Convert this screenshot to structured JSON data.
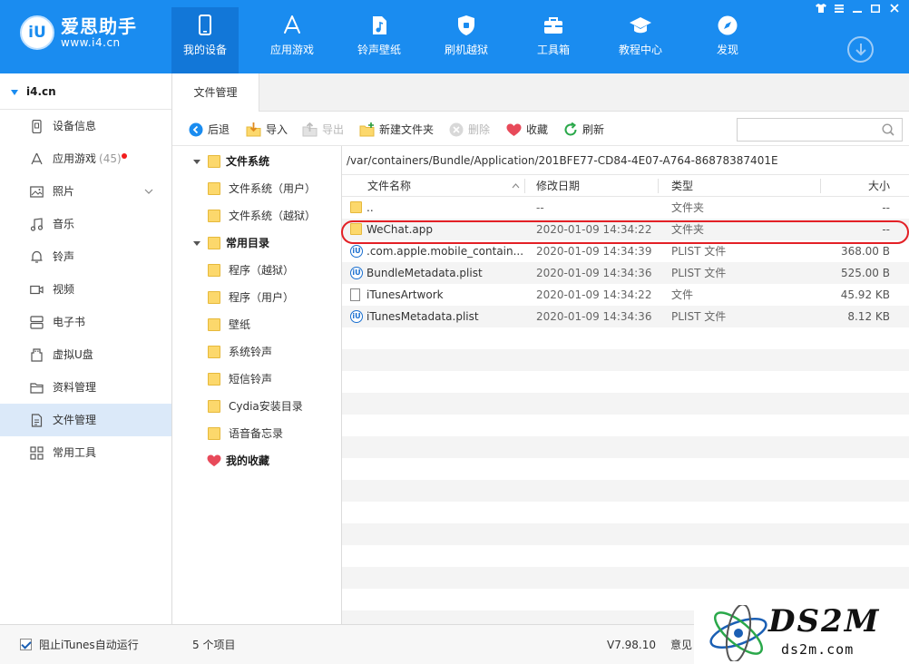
{
  "app": {
    "logo_badge": "iU",
    "logo_name": "爱思助手",
    "logo_url": "www.i4.cn"
  },
  "nav": [
    {
      "label": "我的设备",
      "icon": "phone-icon",
      "active": true
    },
    {
      "label": "应用游戏",
      "icon": "app-store-icon"
    },
    {
      "label": "铃声壁纸",
      "icon": "music-file-icon"
    },
    {
      "label": "刷机越狱",
      "icon": "shield-icon"
    },
    {
      "label": "工具箱",
      "icon": "toolbox-icon"
    },
    {
      "label": "教程中心",
      "icon": "graduation-cap-icon"
    },
    {
      "label": "发现",
      "icon": "compass-icon"
    }
  ],
  "colors": {
    "accent": "#1a8cf0",
    "nav_active": "#1277d8",
    "selected_row": "#dbe9f9",
    "highlight": "#e32026",
    "folder": "#fcd86c"
  },
  "sidebar": {
    "device": "i4.cn",
    "items": [
      {
        "label": "设备信息",
        "icon": "device-info-icon"
      },
      {
        "label": "应用游戏",
        "icon": "apps-icon",
        "count": "(45)",
        "badge": true
      },
      {
        "label": "照片",
        "icon": "photo-icon",
        "expandable": true
      },
      {
        "label": "音乐",
        "icon": "music-note-icon"
      },
      {
        "label": "铃声",
        "icon": "bell-icon"
      },
      {
        "label": "视频",
        "icon": "video-icon"
      },
      {
        "label": "电子书",
        "icon": "ebook-icon"
      },
      {
        "label": "虚拟U盘",
        "icon": "usb-drive-icon"
      },
      {
        "label": "资料管理",
        "icon": "folder-outline-icon"
      },
      {
        "label": "文件管理",
        "icon": "document-icon",
        "active": true
      },
      {
        "label": "常用工具",
        "icon": "grid-icon"
      }
    ]
  },
  "tabs": [
    {
      "label": "文件管理"
    }
  ],
  "toolbar": {
    "back": "后退",
    "import": "导入",
    "export": "导出",
    "new_folder": "新建文件夹",
    "delete": "删除",
    "favorite": "收藏",
    "refresh": "刷新",
    "search_placeholder": ""
  },
  "tree": [
    {
      "label": "文件系统",
      "group": true
    },
    {
      "label": "文件系统（用户）"
    },
    {
      "label": "文件系统（越狱）"
    },
    {
      "label": "常用目录",
      "group": true
    },
    {
      "label": "程序（越狱）"
    },
    {
      "label": "程序（用户）"
    },
    {
      "label": "壁纸"
    },
    {
      "label": "系统铃声"
    },
    {
      "label": "短信铃声"
    },
    {
      "label": "Cydia安装目录"
    },
    {
      "label": "语音备忘录"
    },
    {
      "label": "我的收藏",
      "favorite": true
    }
  ],
  "path": "/var/containers/Bundle/Application/201BFE77-CD84-4E07-A764-86878387401E",
  "columns": {
    "name": "文件名称",
    "date": "修改日期",
    "type": "类型",
    "size": "大小"
  },
  "files": [
    {
      "name": "..",
      "date": "--",
      "type": "文件夹",
      "size": "--",
      "icon": "folder"
    },
    {
      "name": "WeChat.app",
      "date": "2020-01-09 14:34:22",
      "type": "文件夹",
      "size": "--",
      "icon": "folder",
      "highlighted": true
    },
    {
      "name": ".com.apple.mobile_contain...",
      "date": "2020-01-09 14:34:39",
      "type": "PLIST 文件",
      "size": "368.00 B",
      "icon": "itunes"
    },
    {
      "name": "BundleMetadata.plist",
      "date": "2020-01-09 14:34:36",
      "type": "PLIST 文件",
      "size": "525.00 B",
      "icon": "itunes"
    },
    {
      "name": "iTunesArtwork",
      "date": "2020-01-09 14:34:22",
      "type": "文件",
      "size": "45.92 KB",
      "icon": "doc"
    },
    {
      "name": "iTunesMetadata.plist",
      "date": "2020-01-09 14:34:36",
      "type": "PLIST 文件",
      "size": "8.12 KB",
      "icon": "itunes"
    }
  ],
  "status": {
    "block_itunes": "阻止iTunes自动运行",
    "items": "5 个项目",
    "version": "V7.98.10",
    "feedback": "意见"
  },
  "watermark": {
    "main": "DS2M",
    "sub": "ds2m.com"
  }
}
